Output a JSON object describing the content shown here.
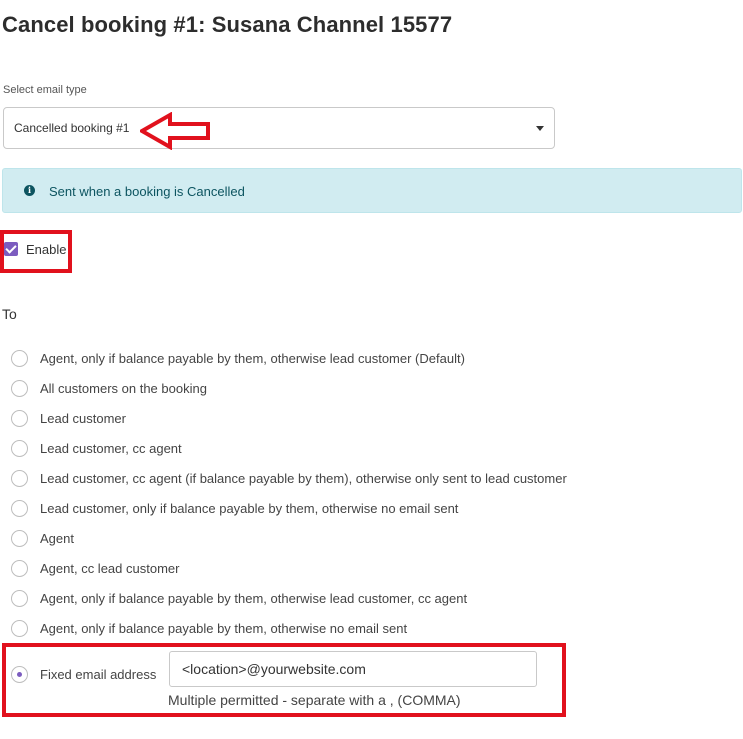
{
  "page": {
    "title": "Cancel booking #1: Susana Channel 15577"
  },
  "email_type": {
    "label": "Select email type",
    "selected": "Cancelled booking #1"
  },
  "info": {
    "text": "Sent when a booking is Cancelled"
  },
  "enable": {
    "label": "Enable",
    "checked": true
  },
  "to": {
    "label": "To",
    "options": [
      "Agent, only if balance payable by them, otherwise lead customer (Default)",
      "All customers on the booking",
      "Lead customer",
      "Lead customer, cc agent",
      "Lead customer, cc agent (if balance payable by them), otherwise only sent to lead customer",
      "Lead customer, only if balance payable by them, otherwise no email sent",
      "Agent",
      "Agent, cc lead customer",
      "Agent, only if balance payable by them, otherwise lead customer, cc agent",
      "Agent, only if balance payable by them, otherwise no email sent",
      "Fixed email address"
    ],
    "selected_index": 10,
    "fixed_email": {
      "value": "<location>@yourwebsite.com",
      "help": "Multiple permitted - separate with a , (COMMA)"
    }
  },
  "colors": {
    "accent": "#7c5cbf",
    "highlight": "#e1111d",
    "info_bg": "#d1ecf1",
    "info_text": "#0c5460"
  },
  "icons": {
    "info": "info-circle-icon",
    "caret": "chevron-down-icon",
    "annotation_arrow": "left-arrow-icon"
  }
}
